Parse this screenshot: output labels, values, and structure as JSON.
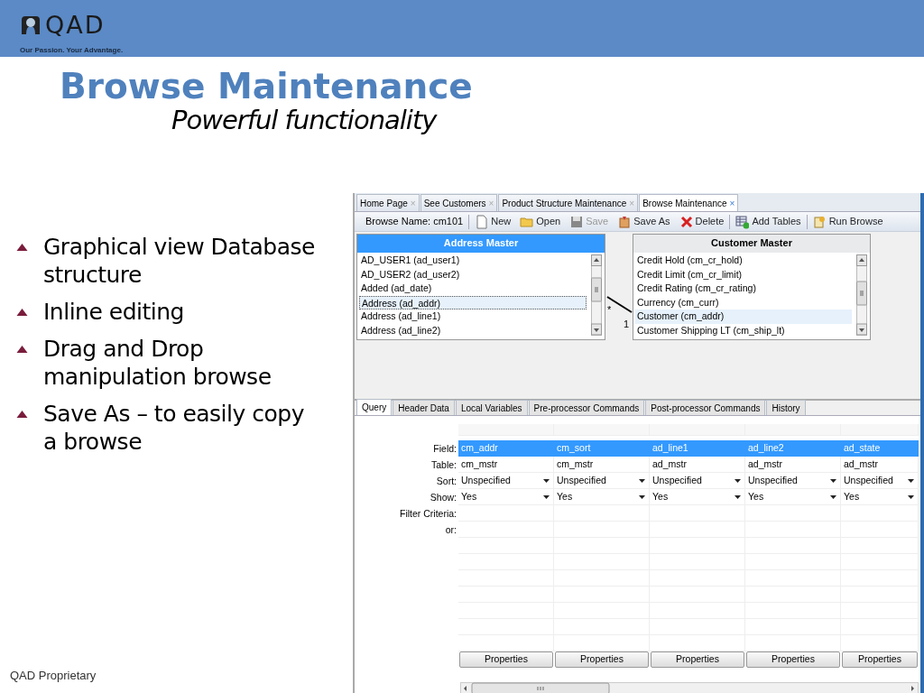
{
  "header": {
    "logo_text": "QAD",
    "tagline": "Our Passion. Your Advantage."
  },
  "title": "Browse Maintenance",
  "subtitle": "Powerful functionality",
  "bullets": [
    "Graphical view Database structure",
    "Inline editing",
    "Drag and Drop manipulation browse",
    "Save As – to easily copy a browse"
  ],
  "footer": "QAD Proprietary",
  "app": {
    "tabs": [
      {
        "label": "Home Page",
        "close": "×",
        "selected": false
      },
      {
        "label": "See Customers",
        "close": "×",
        "selected": false
      },
      {
        "label": "Product Structure Maintenance",
        "close": "×",
        "selected": false
      },
      {
        "label": "Browse Maintenance",
        "close": "×",
        "selected": true
      }
    ],
    "toolbar": {
      "browse_name": "Browse Name: cm101",
      "buttons": [
        {
          "kind": "new",
          "label": "New",
          "disabled": false
        },
        {
          "kind": "open",
          "label": "Open",
          "disabled": false
        },
        {
          "kind": "save",
          "label": "Save",
          "disabled": true
        },
        {
          "kind": "saveas",
          "label": "Save As",
          "disabled": false
        },
        {
          "kind": "delete",
          "label": "Delete",
          "disabled": false
        },
        {
          "kind": "addtables",
          "label": "Add Tables",
          "disabled": false
        },
        {
          "kind": "run",
          "label": "Run Browse",
          "disabled": false
        }
      ]
    },
    "tables": [
      {
        "title": "Address Master",
        "selected": true,
        "rows": [
          {
            "label": "AD_USER1 (ad_user1)",
            "selected": false
          },
          {
            "label": "AD_USER2 (ad_user2)",
            "selected": false
          },
          {
            "label": "Added (ad_date)",
            "selected": false
          },
          {
            "label": "Address (ad_addr)",
            "selected": true
          },
          {
            "label": "Address (ad_line1)",
            "selected": false
          },
          {
            "label": "Address (ad_line2)",
            "selected": false
          }
        ]
      },
      {
        "title": "Customer Master",
        "selected": false,
        "rows": [
          {
            "label": "Credit Hold (cm_cr_hold)",
            "selected": false
          },
          {
            "label": "Credit Limit (cm_cr_limit)",
            "selected": false
          },
          {
            "label": "Credit Rating (cm_cr_rating)",
            "selected": false
          },
          {
            "label": "Currency (cm_curr)",
            "selected": false
          },
          {
            "label": "Customer (cm_addr)",
            "selected": true
          },
          {
            "label": "Customer Shipping LT (cm_ship_lt)",
            "selected": false
          }
        ]
      }
    ],
    "relation": {
      "from": "*",
      "to": "1"
    },
    "query_tabs": [
      {
        "label": "Query",
        "selected": true
      },
      {
        "label": "Header Data",
        "selected": false
      },
      {
        "label": "Local Variables",
        "selected": false
      },
      {
        "label": "Pre-processor Commands",
        "selected": false
      },
      {
        "label": "Post-processor Commands",
        "selected": false
      },
      {
        "label": "History",
        "selected": false
      }
    ],
    "grid": {
      "rows": [
        {
          "label": "Field:",
          "kind": "text",
          "selected": true
        },
        {
          "label": "Table:",
          "kind": "text",
          "selected": false
        },
        {
          "label": "Sort:",
          "kind": "dropdown",
          "selected": false
        },
        {
          "label": "Show:",
          "kind": "dropdown",
          "selected": false
        },
        {
          "label": "Filter Criteria:",
          "kind": "blank",
          "selected": false
        },
        {
          "label": "or:",
          "kind": "blank",
          "selected": false
        }
      ],
      "columns": [
        {
          "values": [
            "cm_addr",
            "cm_mstr",
            "Unspecified",
            "Yes"
          ],
          "button": "Properties"
        },
        {
          "values": [
            "cm_sort",
            "cm_mstr",
            "Unspecified",
            "Yes"
          ],
          "button": "Properties"
        },
        {
          "values": [
            "ad_line1",
            "ad_mstr",
            "Unspecified",
            "Yes"
          ],
          "button": "Properties"
        },
        {
          "values": [
            "ad_line2",
            "ad_mstr",
            "Unspecified",
            "Yes"
          ],
          "button": "Properties"
        },
        {
          "values": [
            "ad_state",
            "ad_mstr",
            "Unspecified",
            "Yes"
          ],
          "button": "Properties"
        }
      ]
    }
  }
}
